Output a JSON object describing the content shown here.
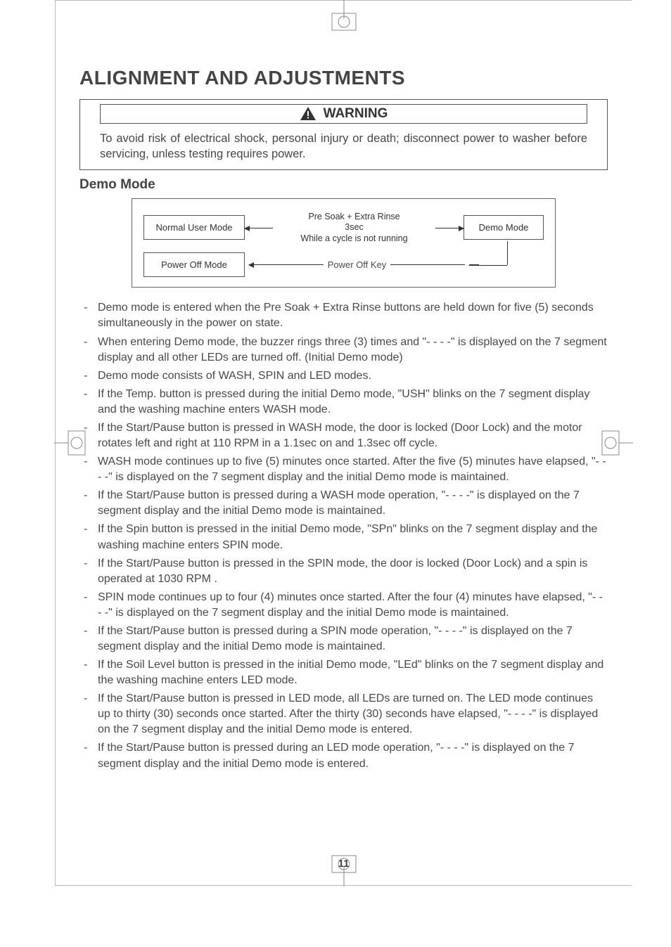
{
  "title": "ALIGNMENT AND ADJUSTMENTS",
  "warning": {
    "label": "WARNING",
    "body": "To avoid risk of electrical shock, personal injury or death; disconnect power to washer before servicing, unless testing requires power."
  },
  "section_heading": "Demo Mode",
  "diagram": {
    "normal_user_mode": "Normal User Mode",
    "demo_mode": "Demo Mode",
    "center_line1": "Pre Soak + Extra Rinse",
    "center_line2": "3sec",
    "center_line3": "While a cycle is not running",
    "power_off_mode": "Power Off Mode",
    "power_off_key": "Power Off Key"
  },
  "bullets": [
    "Demo mode is entered when the Pre Soak + Extra Rinse buttons are held down for five (5) seconds simultaneously in the power on state.",
    "When entering Demo mode, the buzzer rings three (3) times and \"- - - -\" is displayed on the 7 segment display and all other LEDs are turned off. (Initial Demo mode)",
    "Demo mode consists of WASH, SPIN and LED modes.",
    "If the Temp. button is pressed during the initial Demo mode, \"USH\" blinks on the 7 segment display and the washing machine enters WASH mode.",
    "If the Start/Pause button is pressed in WASH mode, the door is locked (Door Lock) and the motor rotates left and right at 110 RPM in a 1.1sec on and 1.3sec off cycle.",
    "WASH mode continues up to five (5) minutes once started. After the five (5) minutes have elapsed, \"- - - -\" is displayed on the 7 segment display and the initial Demo mode is maintained.",
    "If the Start/Pause button is pressed during a WASH mode operation, \"- - - -\" is displayed on the 7 segment display and the initial Demo mode is maintained.",
    "If the Spin button is pressed in the initial Demo mode, \"SPn\" blinks on the 7 segment display and the washing machine enters SPIN mode.",
    "If the Start/Pause button is pressed in the SPIN mode, the door is locked (Door Lock) and a spin is operated at 1030 RPM .",
    "SPIN mode continues up to four (4) minutes once started. After the four (4) minutes have elapsed, \"- - - -\" is displayed on the 7 segment display and the initial Demo mode is maintained.",
    "If the Start/Pause button is pressed during a SPIN mode operation, \"- - - -\" is displayed on the 7 segment display and the initial Demo mode is maintained.",
    "If the Soil Level button is pressed in the initial Demo mode, \"LEd\" blinks on the 7 segment display and the washing machine enters LED mode.",
    "If the Start/Pause button is pressed in LED mode, all LEDs are turned on. The LED mode continues up to thirty (30) seconds once started. After the thirty (30) seconds have elapsed, \"- - - -\" is displayed on the 7 segment display and the initial Demo mode is entered.",
    "If the Start/Pause button is pressed during an LED mode operation, \"- - - -\" is displayed on the 7 segment display and the initial Demo mode is entered."
  ],
  "page_number": "11"
}
